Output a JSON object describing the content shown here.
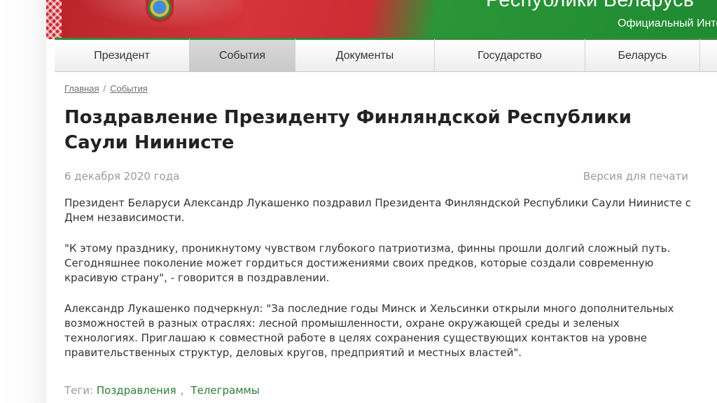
{
  "header": {
    "title": "Республики Беларусь",
    "subtitle": "Официальный Интернет"
  },
  "nav": {
    "items": [
      {
        "label": "Президент"
      },
      {
        "label": "События"
      },
      {
        "label": "Документы"
      },
      {
        "label": "Государство"
      },
      {
        "label": "Беларусь"
      }
    ],
    "active": "События"
  },
  "breadcrumb": {
    "home": "Главная",
    "separator": "/",
    "current": "События"
  },
  "article": {
    "title": "Поздравление Президенту Финляндской Республики Саули Ниинисте",
    "date": "6 декабря 2020 года",
    "print_label": "Версия для печати",
    "paragraphs": [
      "Президент Беларуси Александр Лукашенко поздравил Президента Финляндской Республики Саули Ниинисте с Днем независимости.",
      "\"К этому празднику, проникнутому чувством глубокого патриотизма, финны прошли долгий сложный путь. Сегодняшнее поколение может гордиться достижениями своих предков, которые создали современную красивую страну\", - говорится в поздравлении.",
      "Александр Лукашенко подчеркнул: \"За последние годы Минск и Хельсинки открыли много дополнительных возможностей в разных отраслях: лесной промышленности, охране окружающей среды и зеленых технологиях. Приглашаю к совместной работе в целях сохранения существующих контактов на уровне правительственных структур, деловых кругов, предприятий и местных властей\"."
    ]
  },
  "tags": {
    "label": "Теги:",
    "separator": ",",
    "items": [
      "Поздравления",
      "Телеграммы"
    ]
  },
  "colors": {
    "flag_red": "#c8252d",
    "flag_green": "#2a9637",
    "tag_link": "#2d7d33"
  }
}
